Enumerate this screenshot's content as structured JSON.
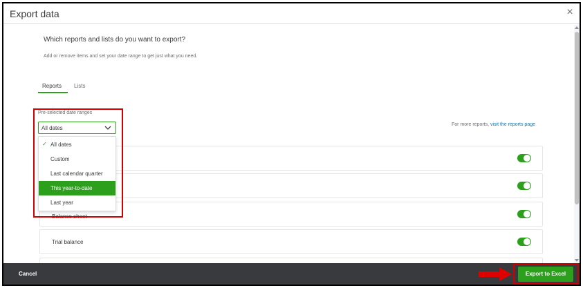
{
  "dialog": {
    "title": "Export data",
    "close_glyph": "×",
    "heading": "Which reports and lists do you want to export?",
    "subheading": "Add or remove items and set your date range to get just what you need."
  },
  "tabs": [
    {
      "label": "Reports",
      "active": true
    },
    {
      "label": "Lists",
      "active": false
    }
  ],
  "date_range": {
    "label": "Pre-selected date ranges",
    "selected": "All dates",
    "options": [
      {
        "label": "All dates",
        "checked": true,
        "highlighted": false
      },
      {
        "label": "Custom",
        "checked": false,
        "highlighted": false
      },
      {
        "label": "Last calendar quarter",
        "checked": false,
        "highlighted": false
      },
      {
        "label": "This year-to-date",
        "checked": false,
        "highlighted": true
      },
      {
        "label": "Last year",
        "checked": false,
        "highlighted": false
      }
    ]
  },
  "more_reports": {
    "prefix": "For more reports, ",
    "link": "visit the reports page"
  },
  "report_rows": [
    {
      "label": "",
      "enabled": true
    },
    {
      "label": "",
      "enabled": true
    },
    {
      "label": "Balance sheet",
      "enabled": true
    },
    {
      "label": "Trial balance",
      "enabled": true
    }
  ],
  "footer": {
    "cancel_label": "Cancel",
    "export_label": "Export to Excel"
  },
  "colors": {
    "accent": "#2ca01c",
    "footer_bg": "#393a3d",
    "highlight": "#d10000",
    "link": "#0077c5"
  }
}
